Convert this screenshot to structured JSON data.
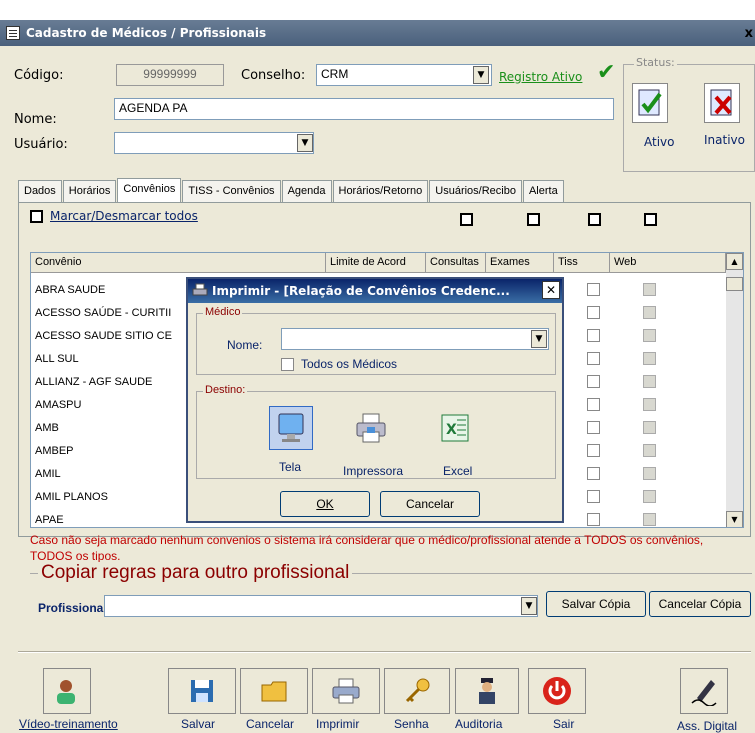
{
  "window": {
    "title": "Cadastro de Médicos / Profissionais",
    "close_label": "x"
  },
  "form": {
    "codigo_label": "Código:",
    "codigo_value": "99999999",
    "conselho_label": "Conselho:",
    "conselho_value": "CRM",
    "registro_ativo": "Registro Ativo",
    "nome_label": "Nome:",
    "nome_value": "AGENDA PA",
    "usuario_label": "Usuário:",
    "usuario_value": ""
  },
  "status": {
    "legend": "Status:",
    "ativo_label": "Ativo",
    "inativo_label": "Inativo"
  },
  "tabs": [
    {
      "label": "Dados"
    },
    {
      "label": "Horários"
    },
    {
      "label": "Convênios"
    },
    {
      "label": "TISS - Convênios"
    },
    {
      "label": "Agenda"
    },
    {
      "label": "Horários/Retorno"
    },
    {
      "label": "Usuários/Recibo"
    },
    {
      "label": "Alerta"
    }
  ],
  "convenios": {
    "toggle_all": "Marcar/Desmarcar todos",
    "headers": {
      "convenio": "Convênio",
      "limite": "Limite de Acord",
      "consultas": "Consultas",
      "exames": "Exames",
      "tiss": "Tiss",
      "web": "Web"
    },
    "rows": [
      "ABRA SAUDE",
      "ACESSO SAÚDE - CURITII",
      "ACESSO SAUDE SITIO CE",
      "ALL SUL",
      "ALLIANZ - AGF SAUDE",
      "AMASPU",
      "AMB",
      "AMBEP",
      "AMIL",
      "AMIL PLANOS",
      "APAE"
    ],
    "note": "Caso não seja marcado nenhum convenios o sistema irá considerar que o médico/profissional atende a TODOS os convênios, TODOS os tipos."
  },
  "copy": {
    "title": "Copiar regras para outro profissional",
    "profissional_label": "Profissional:",
    "profissional_value": "",
    "save_label": "Salvar Cópia",
    "cancel_label": "Cancelar Cópia"
  },
  "dialog": {
    "title": "Imprimir - [Relação de Convênios Credenc...",
    "medico_legend": "Médico",
    "nome_label": "Nome:",
    "nome_value": "",
    "todos_label": "Todos os Médicos",
    "destino_legend": "Destino:",
    "tela_label": "Tela",
    "impressora_label": "Impressora",
    "excel_label": "Excel",
    "ok_label": "OK",
    "cancel_label": "Cancelar"
  },
  "toolbar": {
    "video": "Vídeo-treinamento",
    "salvar": "Salvar",
    "cancelar": "Cancelar",
    "imprimir": "Imprimir",
    "senha": "Senha",
    "auditoria": "Auditoria",
    "sair": "Sair",
    "ass_digital": "Ass. Digital"
  },
  "colors": {
    "note_red": "#c00000",
    "section_title": "#8b0000",
    "link": "#0a246a"
  }
}
